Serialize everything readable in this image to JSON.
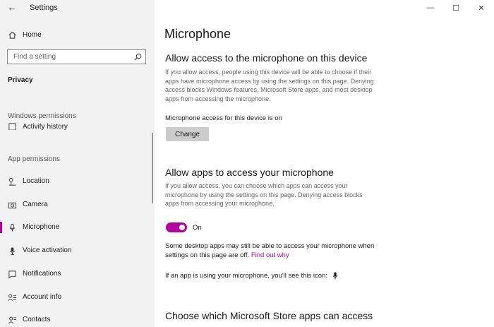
{
  "window": {
    "title": "Settings",
    "minimize": "—",
    "maximize": "☐",
    "close": "✕"
  },
  "sidebar": {
    "home_label": "Home",
    "search_placeholder": "Find a setting",
    "section_heading": "Privacy",
    "windows_permissions_label": "Windows permissions",
    "partial_item_label": "Activity history",
    "app_permissions_label": "App permissions",
    "items": [
      {
        "label": "Location",
        "icon": "location-icon"
      },
      {
        "label": "Camera",
        "icon": "camera-icon"
      },
      {
        "label": "Microphone",
        "icon": "microphone-icon",
        "selected": true
      },
      {
        "label": "Voice activation",
        "icon": "voice-activation-icon"
      },
      {
        "label": "Notifications",
        "icon": "notifications-icon"
      },
      {
        "label": "Account info",
        "icon": "account-info-icon"
      },
      {
        "label": "Contacts",
        "icon": "contacts-icon"
      }
    ]
  },
  "main": {
    "page_title": "Microphone",
    "device_section": {
      "heading": "Allow access to the microphone on this device",
      "description": "If you allow access, people using this device will be able to choose if their apps have microphone access by using the settings on this page. Denying access blocks Windows features, Microsoft Store apps, and most desktop apps from accessing the microphone.",
      "status": "Microphone access for this device is on",
      "change_button": "Change"
    },
    "apps_section": {
      "heading": "Allow apps to access your microphone",
      "description": "If you allow access, you can choose which apps can access your microphone by using the settings on this page. Denying access blocks apps from accessing your microphone.",
      "toggle_state": "On",
      "desktop_note": "Some desktop apps may still be able to access your microphone when settings on this page are off.",
      "find_out_link": "Find out why",
      "icon_note": "If an app is using your microphone, you'll see this icon:"
    },
    "store_section": {
      "heading": "Choose which Microsoft Store apps can access"
    }
  },
  "colors": {
    "accent": "#b4009e",
    "sidebar_bg": "#f2f2f2",
    "button_bg": "#cccccc"
  }
}
